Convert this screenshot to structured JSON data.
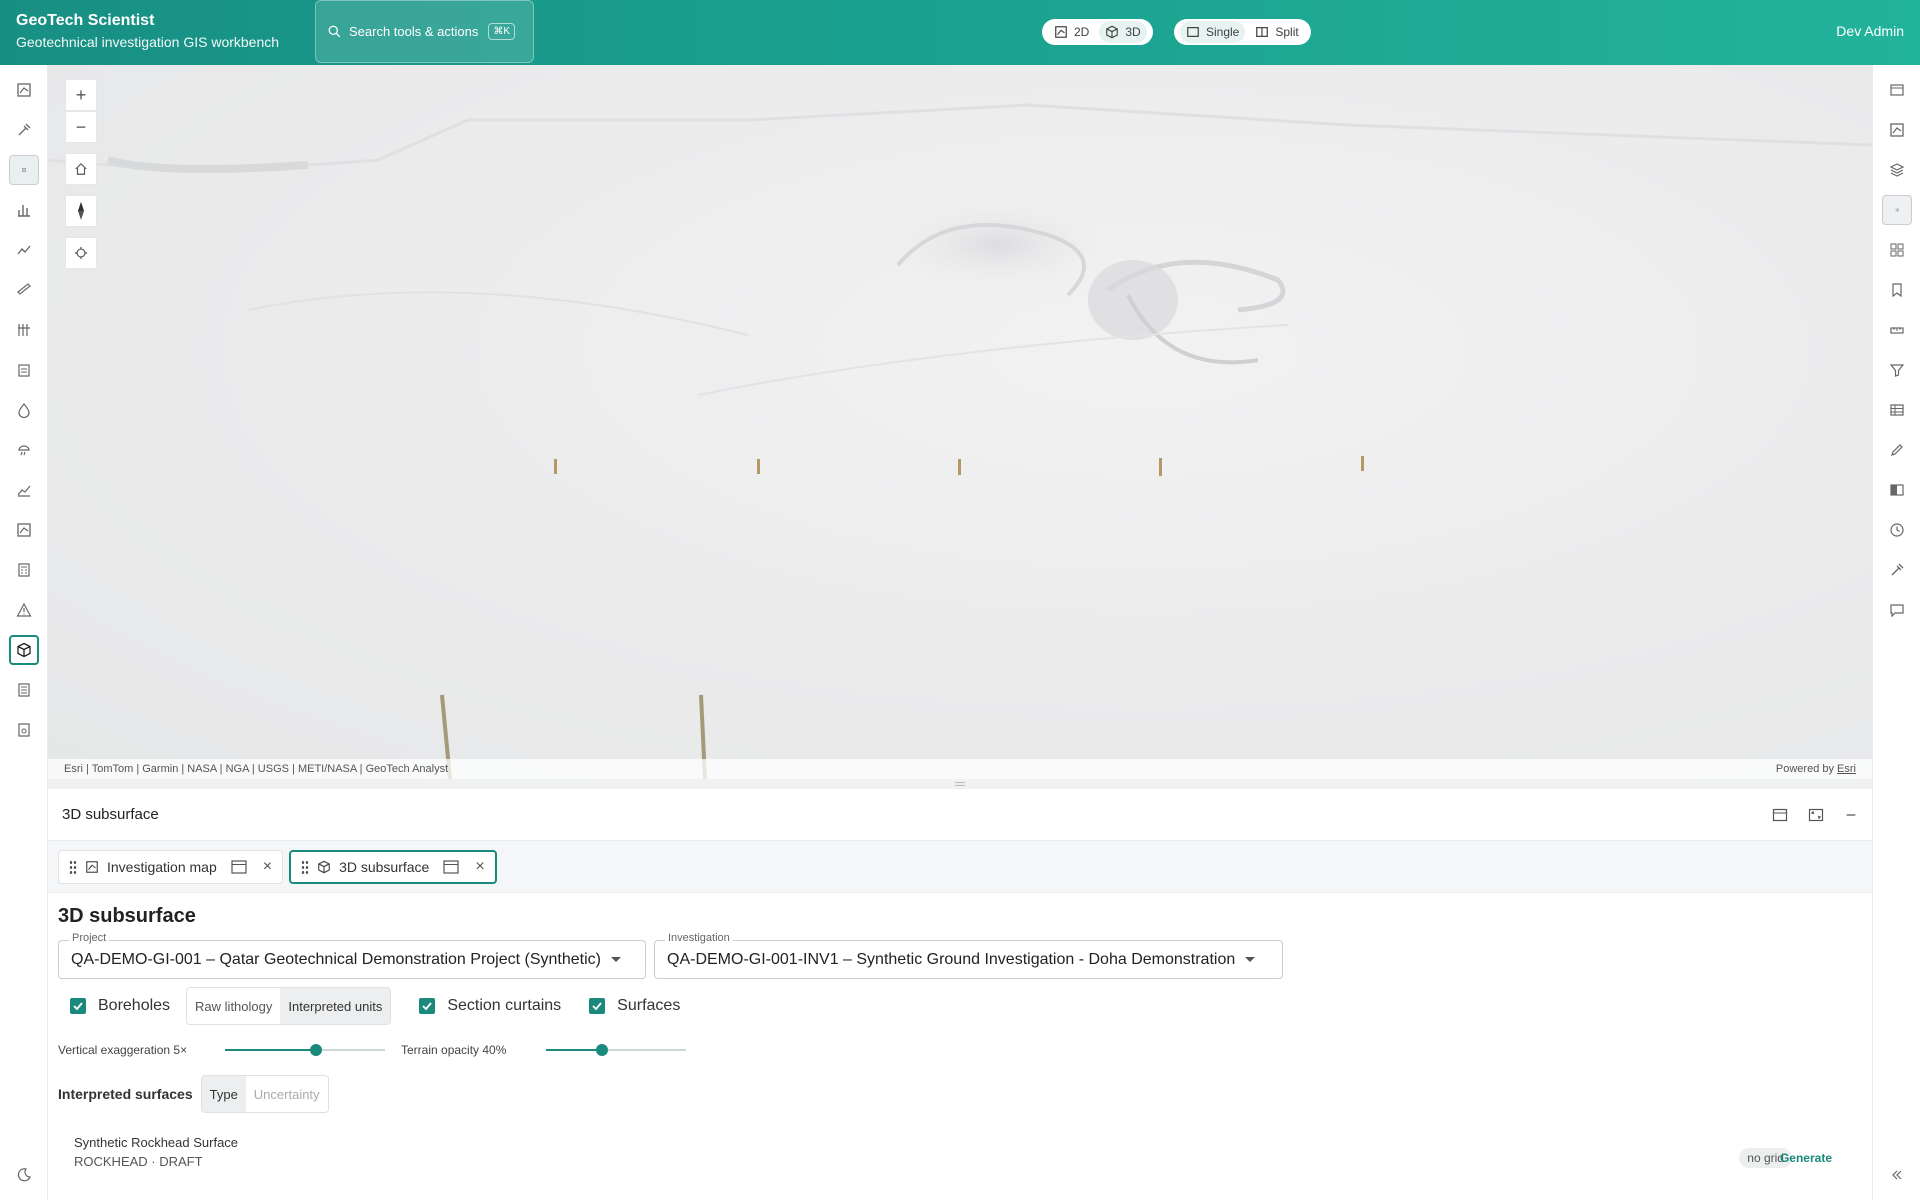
{
  "app": {
    "title": "GeoTech Scientist",
    "subtitle": "Geotechnical investigation GIS workbench",
    "search_placeholder": "Search tools & actions",
    "search_shortcut": "⌘K",
    "view_2d": "2D",
    "view_3d": "3D",
    "layout_single": "Single",
    "layout_split": "Split",
    "user": "Dev Admin"
  },
  "map": {
    "attribution": "Esri | TomTom | Garmin | NASA | NGA | USGS | METI/NASA | GeoTech Analyst",
    "powered_by": "Powered by",
    "powered_link": "Esri",
    "zoom_in": "+",
    "zoom_out": "−"
  },
  "panel": {
    "title": "3D subsurface",
    "tabs": [
      {
        "label": "Investigation map",
        "close": "×"
      },
      {
        "label": "3D subsurface",
        "close": "×"
      }
    ],
    "heading": "3D subsurface",
    "project": {
      "label": "Project",
      "value": "QA-DEMO-GI-001 – Qatar Geotechnical Demonstration Project (Synthetic)"
    },
    "investigation": {
      "label": "Investigation",
      "value": "QA-DEMO-GI-001-INV1 – Synthetic Ground Investigation - Doha Demonstration"
    },
    "boreholes": "Boreholes",
    "lith_raw": "Raw lithology",
    "lith_interp": "Interpreted units",
    "section_curtains": "Section curtains",
    "surfaces": "Surfaces",
    "vert_exag": "Vertical exaggeration 5×",
    "vert_exag_value": 0.57,
    "terrain_opacity": "Terrain opacity 40%",
    "terrain_opacity_value": 0.4,
    "interp_surfaces": "Interpreted surfaces",
    "mode_type": "Type",
    "mode_uncertainty": "Uncertainty",
    "surface_name": "Synthetic Rockhead Surface",
    "surface_status": "ROCKHEAD · DRAFT",
    "no_grid": "no grid",
    "generate": "Generate"
  }
}
